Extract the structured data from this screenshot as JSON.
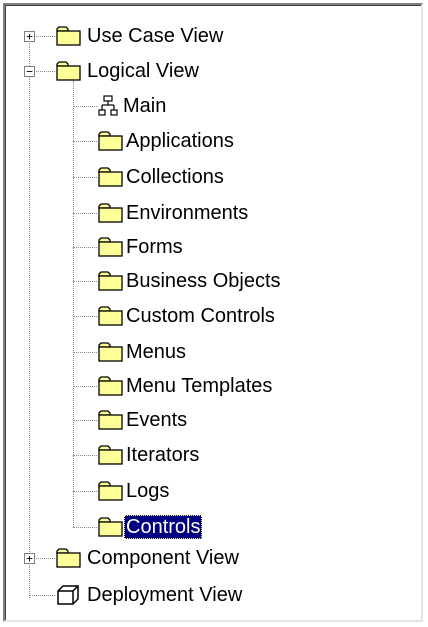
{
  "tree": {
    "root_items": [
      {
        "label": "Use Case View",
        "icon": "folder-icon",
        "expanded": false
      },
      {
        "label": "Logical View",
        "icon": "folder-icon",
        "expanded": true
      },
      {
        "label": "Component View",
        "icon": "folder-icon",
        "expanded": false
      },
      {
        "label": "Deployment View",
        "icon": "cube-icon"
      }
    ],
    "logical_children": [
      {
        "label": "Main",
        "icon": "class-diagram-icon"
      },
      {
        "label": "Applications",
        "icon": "folder-icon"
      },
      {
        "label": "Collections",
        "icon": "folder-icon"
      },
      {
        "label": "Environments",
        "icon": "folder-icon"
      },
      {
        "label": "Forms",
        "icon": "folder-icon"
      },
      {
        "label": "Business Objects",
        "icon": "folder-icon"
      },
      {
        "label": "Custom Controls",
        "icon": "folder-icon"
      },
      {
        "label": "Menus",
        "icon": "folder-icon"
      },
      {
        "label": "Menu Templates",
        "icon": "folder-icon"
      },
      {
        "label": "Events",
        "icon": "folder-icon"
      },
      {
        "label": "Iterators",
        "icon": "folder-icon"
      },
      {
        "label": "Logs",
        "icon": "folder-icon"
      },
      {
        "label": "Controls",
        "icon": "folder-icon",
        "selected": true
      }
    ],
    "expander_collapsed": "+",
    "expander_expanded": "−",
    "colors": {
      "folder_fill": "#ffff99",
      "folder_outline": "#000000",
      "selection_bg": "#000080",
      "selection_text": "#ffffff"
    }
  }
}
